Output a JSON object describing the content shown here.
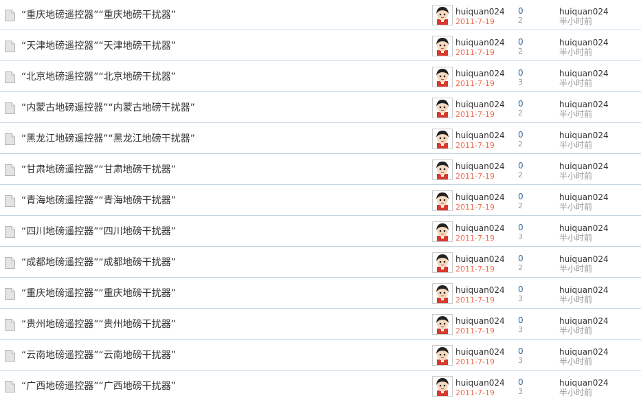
{
  "threads": [
    {
      "title": "“重庆地磅遥控器”“重庆地磅干扰器”",
      "author": "huiquan024",
      "date": "2011-7-19",
      "replies": "0",
      "views": "2",
      "last_poster": "huiquan024",
      "last_time": "半小时前"
    },
    {
      "title": "“天津地磅遥控器”“天津地磅干扰器”",
      "author": "huiquan024",
      "date": "2011-7-19",
      "replies": "0",
      "views": "2",
      "last_poster": "huiquan024",
      "last_time": "半小时前"
    },
    {
      "title": "“北京地磅遥控器”“北京地磅干扰器”",
      "author": "huiquan024",
      "date": "2011-7-19",
      "replies": "0",
      "views": "3",
      "last_poster": "huiquan024",
      "last_time": "半小时前"
    },
    {
      "title": "“内蒙古地磅遥控器”“内蒙古地磅干扰器”",
      "author": "huiquan024",
      "date": "2011-7-19",
      "replies": "0",
      "views": "2",
      "last_poster": "huiquan024",
      "last_time": "半小时前"
    },
    {
      "title": "“黑龙江地磅遥控器”“黑龙江地磅干扰器”",
      "author": "huiquan024",
      "date": "2011-7-19",
      "replies": "0",
      "views": "2",
      "last_poster": "huiquan024",
      "last_time": "半小时前"
    },
    {
      "title": "“甘肃地磅遥控器”“甘肃地磅干扰器”",
      "author": "huiquan024",
      "date": "2011-7-19",
      "replies": "0",
      "views": "2",
      "last_poster": "huiquan024",
      "last_time": "半小时前"
    },
    {
      "title": "“青海地磅遥控器”“青海地磅干扰器”",
      "author": "huiquan024",
      "date": "2011-7-19",
      "replies": "0",
      "views": "2",
      "last_poster": "huiquan024",
      "last_time": "半小时前"
    },
    {
      "title": "“四川地磅遥控器”“四川地磅干扰器”",
      "author": "huiquan024",
      "date": "2011-7-19",
      "replies": "0",
      "views": "3",
      "last_poster": "huiquan024",
      "last_time": "半小时前"
    },
    {
      "title": "“成都地磅遥控器”“成都地磅干扰器”",
      "author": "huiquan024",
      "date": "2011-7-19",
      "replies": "0",
      "views": "2",
      "last_poster": "huiquan024",
      "last_time": "半小时前"
    },
    {
      "title": "“重庆地磅遥控器”“重庆地磅干扰器”",
      "author": "huiquan024",
      "date": "2011-7-19",
      "replies": "0",
      "views": "3",
      "last_poster": "huiquan024",
      "last_time": "半小时前"
    },
    {
      "title": "“贵州地磅遥控器”“贵州地磅干扰器”",
      "author": "huiquan024",
      "date": "2011-7-19",
      "replies": "0",
      "views": "3",
      "last_poster": "huiquan024",
      "last_time": "半小时前"
    },
    {
      "title": "“云南地磅遥控器”“云南地磅干扰器”",
      "author": "huiquan024",
      "date": "2011-7-19",
      "replies": "0",
      "views": "3",
      "last_poster": "huiquan024",
      "last_time": "半小时前"
    },
    {
      "title": "“广西地磅遥控器”“广西地磅干扰器”",
      "author": "huiquan024",
      "date": "2011-7-19",
      "replies": "0",
      "views": "3",
      "last_poster": "huiquan024",
      "last_time": "半小时前"
    }
  ],
  "icons": {
    "thread_icon": "document-icon",
    "avatar_icon": "user-avatar-icon"
  },
  "colors": {
    "divider": "#c2d5e3",
    "date": "#f26c4f",
    "replies": "#336699",
    "muted": "#999999",
    "text": "#333333"
  }
}
